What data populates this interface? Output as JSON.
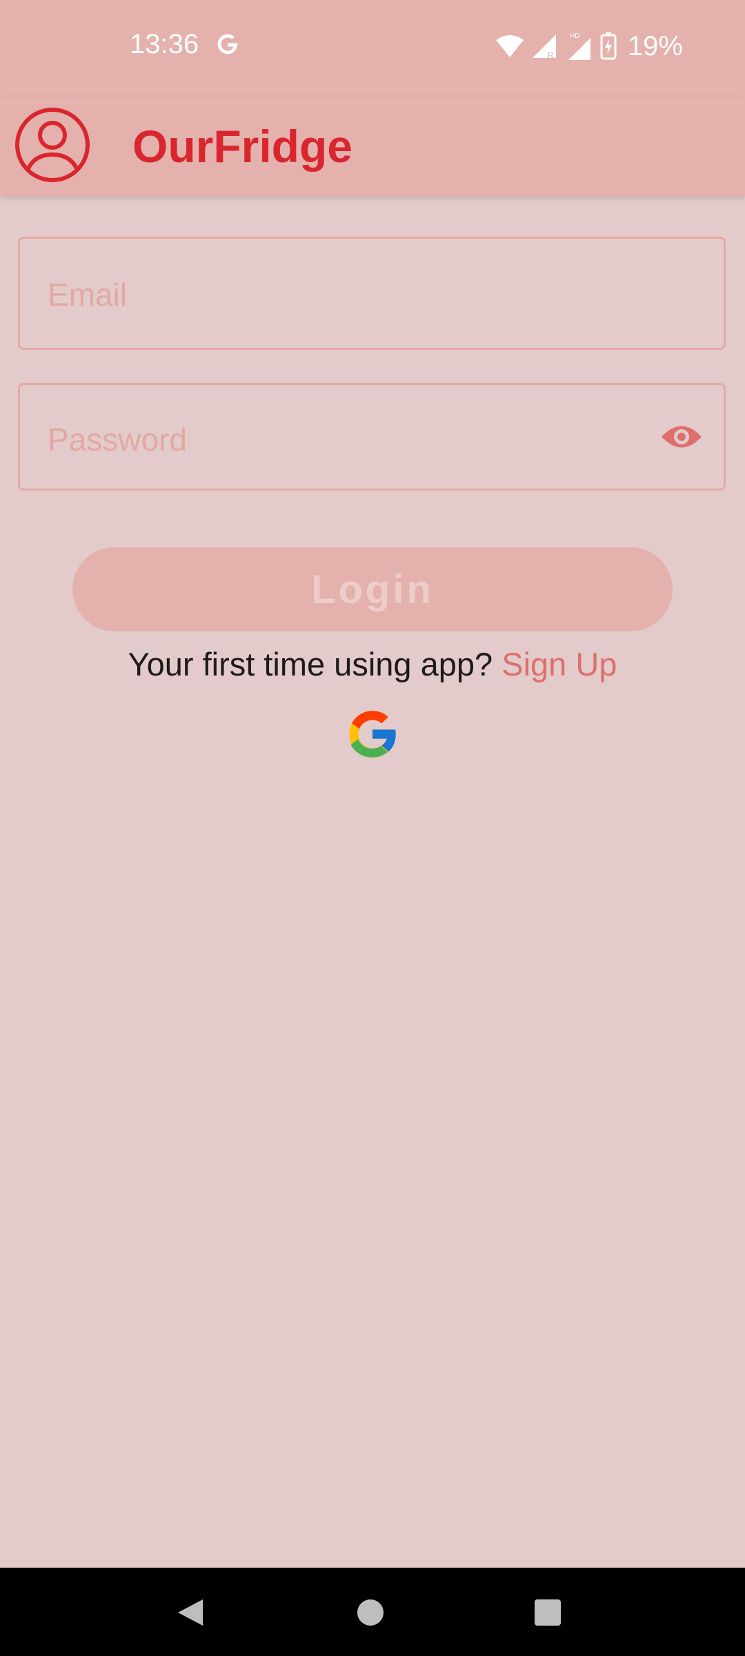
{
  "status_bar": {
    "time": "13:36",
    "battery_percent": "19%",
    "icons": [
      "google-icon",
      "wifi-icon",
      "signal-r-icon",
      "signal-hd-icon",
      "battery-charging-icon"
    ]
  },
  "app_bar": {
    "title": "OurFridge",
    "avatar_icon": "account-circle-icon"
  },
  "form": {
    "email_placeholder": "Email",
    "password_placeholder": "Password",
    "password_toggle_icon": "eye-icon",
    "login_label": "Login",
    "signup_prompt": "Your first time using app? ",
    "signup_link": "Sign Up",
    "google_signin_icon": "google-logo-icon"
  },
  "colors": {
    "bar": "#E4B1AC",
    "background": "#E3CBCB",
    "accent": "#D9262E",
    "link": "#DD6F6C"
  },
  "nav_bar": {
    "icons": [
      "back-icon",
      "home-icon",
      "recents-icon"
    ]
  }
}
